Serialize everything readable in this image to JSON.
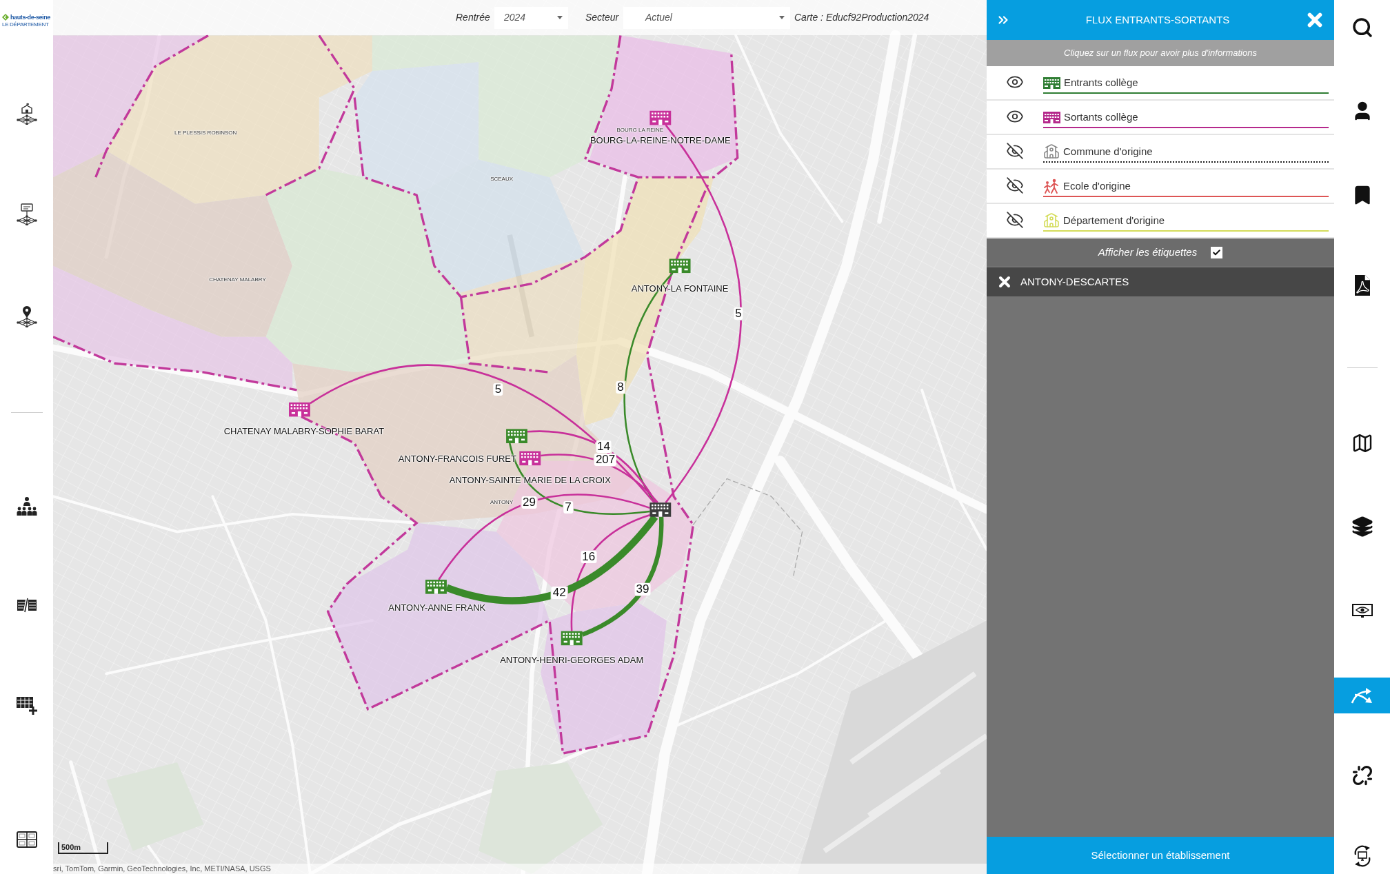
{
  "logo": {
    "name": "hauts-de-seine",
    "tagline": "LE DÉPARTEMENT"
  },
  "top_bar": {
    "fields": [
      {
        "label": "Rentrée",
        "value": "2024"
      },
      {
        "label": "Secteur",
        "value": "Actuel"
      }
    ],
    "map_name": "Carte : Educf92Production2024"
  },
  "map": {
    "commune_labels": [
      "LE PLESSIS ROBINSON",
      "SCEAUX",
      "CHATENAY MALABRY",
      "BOURG LA REINE",
      "ANTONY"
    ],
    "schools": [
      {
        "name": "BOURG-LA-REINE-NOTRE-DAME",
        "kind": "sortant"
      },
      {
        "name": "ANTONY-LA FONTAINE",
        "kind": "entrant"
      },
      {
        "name": "CHATENAY MALABRY-SOPHIE BARAT",
        "kind": "sortant"
      },
      {
        "name": "ANTONY-FRANCOIS FURET",
        "kind": "entrant"
      },
      {
        "name": "ANTONY-SAINTE MARIE DE LA CROIX",
        "kind": "sortant"
      },
      {
        "kind": "selected"
      },
      {
        "name": "ANTONY-ANNE FRANK",
        "kind": "entrant"
      },
      {
        "name": "ANTONY-HENRI-GEORGES ADAM",
        "kind": "entrant"
      }
    ],
    "flows": [
      {
        "count": "5",
        "kind": "sortant"
      },
      {
        "count": "8",
        "kind": "entrant"
      },
      {
        "count": "5",
        "kind": "sortant"
      },
      {
        "count": "14",
        "kind": "sortant"
      },
      {
        "count": "207",
        "kind": "sortant"
      },
      {
        "count": "7",
        "kind": "entrant"
      },
      {
        "count": "29",
        "kind": "sortant"
      },
      {
        "count": "16",
        "kind": "sortant"
      },
      {
        "count": "39",
        "kind": "entrant"
      },
      {
        "count": "42",
        "kind": "entrant"
      }
    ],
    "scale_bar": "500m",
    "attribution": "sri, TomTom, Garmin, GeoTechnologies, Inc, METI/NASA, USGS"
  },
  "panel": {
    "title": "FLUX ENTRANTS-SORTANTS",
    "hint": "Cliquez sur un flux pour avoir plus d'informations",
    "legend": [
      {
        "label": "Entrants collège",
        "kind": "entrants",
        "visible": true,
        "color": "#2e7d32"
      },
      {
        "label": "Sortants collège",
        "kind": "sortants",
        "visible": true,
        "color": "#b5298c"
      },
      {
        "label": "Commune d'origine",
        "kind": "commune",
        "visible": false,
        "color": "#222222"
      },
      {
        "label": "Ecole d'origine",
        "kind": "ecole",
        "visible": false,
        "color": "#dd5555"
      },
      {
        "label": "Département d'origine",
        "kind": "departement",
        "visible": false,
        "color": "#d4dc5a"
      }
    ],
    "labels_toggle": {
      "label": "Afficher les étiquettes",
      "checked": true
    },
    "selection": "ANTONY-DESCARTES",
    "action": "Sélectionner un établissement"
  },
  "right_toolbar": [
    {
      "kind": "search",
      "selected": false
    },
    {
      "kind": "user",
      "selected": false
    },
    {
      "kind": "bookmark",
      "selected": false
    },
    {
      "kind": "pdf",
      "selected": false
    },
    {
      "kind": "map",
      "selected": false
    },
    {
      "kind": "layers",
      "selected": false
    },
    {
      "kind": "view",
      "selected": false
    },
    {
      "kind": "flows",
      "selected": true
    },
    {
      "kind": "unlink",
      "selected": false
    },
    {
      "kind": "sync",
      "selected": false
    }
  ]
}
